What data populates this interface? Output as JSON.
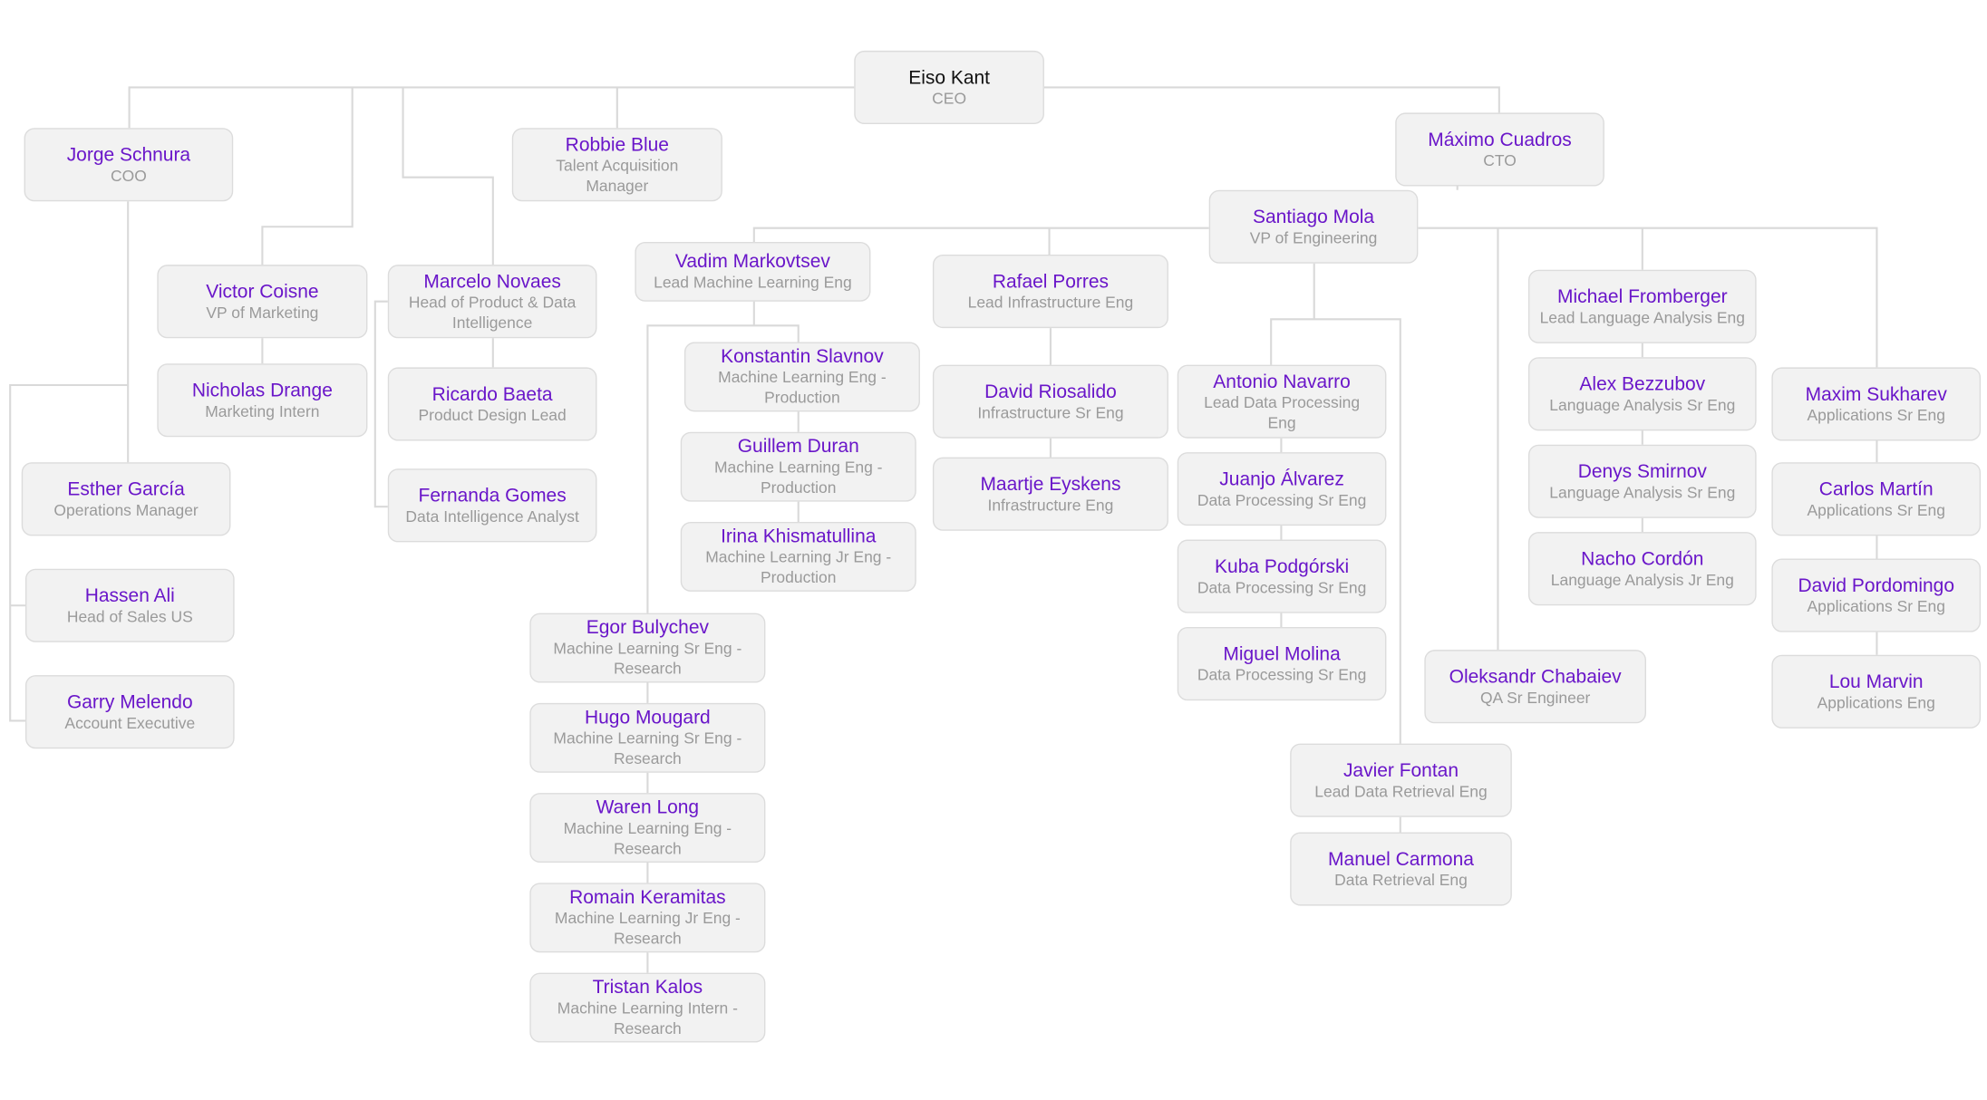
{
  "colors": {
    "name": "#6a16c9",
    "root_name": "#111111",
    "title": "#9a9a9a",
    "box": "#f2f2f2",
    "line": "#d9d9d9"
  },
  "nodes": [
    {
      "name": "Eiso Kant",
      "title": "CEO"
    },
    {
      "name": "Jorge Schnura",
      "title": "COO"
    },
    {
      "name": "Robbie Blue",
      "title": "Talent Acquisition Manager"
    },
    {
      "name": "Máximo Cuadros",
      "title": "CTO"
    },
    {
      "name": "Santiago Mola",
      "title": "VP of Engineering"
    },
    {
      "name": "Victor Coisne",
      "title": "VP of Marketing"
    },
    {
      "name": "Marcelo Novaes",
      "title": "Head of Product & Data Intelligence"
    },
    {
      "name": "Vadim Markovtsev",
      "title": "Lead Machine Learning Eng"
    },
    {
      "name": "Rafael Porres",
      "title": "Lead Infrastructure Eng"
    },
    {
      "name": "Michael Fromberger",
      "title": "Lead Language Analysis Eng"
    },
    {
      "name": "Nicholas Drange",
      "title": "Marketing Intern"
    },
    {
      "name": "Ricardo Baeta",
      "title": "Product Design Lead"
    },
    {
      "name": "Fernanda Gomes",
      "title": "Data Intelligence Analyst"
    },
    {
      "name": "Konstantin Slavnov",
      "title": "Machine Learning Eng - Production"
    },
    {
      "name": "Guillem Duran",
      "title": "Machine Learning Eng - Production"
    },
    {
      "name": "Irina Khismatullina",
      "title": "Machine Learning Jr Eng - Production"
    },
    {
      "name": "David Riosalido",
      "title": "Infrastructure Sr Eng"
    },
    {
      "name": "Maartje Eyskens",
      "title": "Infrastructure Eng"
    },
    {
      "name": "Antonio Navarro",
      "title": "Lead Data Processing Eng"
    },
    {
      "name": "Juanjo Álvarez",
      "title": "Data Processing Sr Eng"
    },
    {
      "name": "Kuba Podgórski",
      "title": "Data Processing Sr Eng"
    },
    {
      "name": "Miguel Molina",
      "title": "Data Processing Sr Eng"
    },
    {
      "name": "Alex Bezzubov",
      "title": "Language Analysis Sr Eng"
    },
    {
      "name": "Denys Smirnov",
      "title": "Language Analysis Sr Eng"
    },
    {
      "name": "Nacho Cordón",
      "title": "Language Analysis Jr Eng"
    },
    {
      "name": "Maxim Sukharev",
      "title": "Applications Sr Eng"
    },
    {
      "name": "Carlos Martín",
      "title": "Applications Sr Eng"
    },
    {
      "name": "David Pordomingo",
      "title": "Applications Sr Eng"
    },
    {
      "name": "Lou Marvin",
      "title": "Applications Eng"
    },
    {
      "name": "Oleksandr Chabaiev",
      "title": "QA Sr Engineer"
    },
    {
      "name": "Javier Fontan",
      "title": "Lead Data Retrieval Eng"
    },
    {
      "name": "Manuel Carmona",
      "title": "Data Retrieval Eng"
    },
    {
      "name": "Esther García",
      "title": "Operations Manager"
    },
    {
      "name": "Hassen Ali",
      "title": "Head of Sales US"
    },
    {
      "name": "Garry Melendo",
      "title": "Account Executive"
    },
    {
      "name": "Egor Bulychev",
      "title": "Machine Learning Sr Eng - Research"
    },
    {
      "name": "Hugo Mougard",
      "title": "Machine Learning Sr Eng - Research"
    },
    {
      "name": "Waren Long",
      "title": "Machine Learning Eng - Research"
    },
    {
      "name": "Romain Keramitas",
      "title": "Machine Learning Jr Eng - Research"
    },
    {
      "name": "Tristan Kalos",
      "title": "Machine Learning Intern - Research"
    }
  ]
}
